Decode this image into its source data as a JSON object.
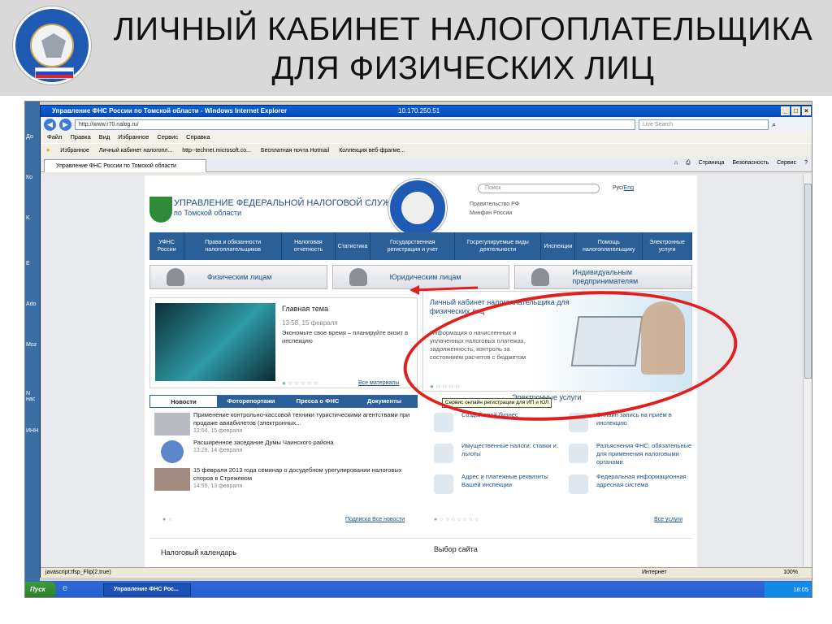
{
  "slide": {
    "title_line1": "ЛИЧНЫЙ КАБИНЕТ НАЛОГОПЛАТЕЛЬЩИКА",
    "title_line2": "ДЛЯ ФИЗИЧЕСКИХ ЛИЦ"
  },
  "left_strip": [
    "До",
    "Ко",
    "K",
    "E",
    "Ado",
    "Moz",
    "N нас",
    "ИНН"
  ],
  "browser": {
    "window_title": "Управление ФНС России по Томской области - Windows Internet Explorer",
    "remote_ip": "10.170.250.51",
    "address": "http://www.r70.nalog.ru/",
    "search_placeholder": "Live Search",
    "menu": [
      "Файл",
      "Правка",
      "Вид",
      "Избранное",
      "Сервис",
      "Справка"
    ],
    "favorites": [
      "Избранное",
      "Личный кабинет налогопл...",
      "http--technet.microsoft.co...",
      "Бесплатная почта Hotmail",
      "Коллекция веб-фрагме..."
    ],
    "tab_title": "Управление ФНС России по Томской области",
    "tab_tools": [
      "Страница",
      "Безопасность",
      "Сервис"
    ],
    "status_text": "javascript:tfsp_Flip(2,true)",
    "status_zone": "Интернет",
    "status_zoom": "100%"
  },
  "site": {
    "name": "УПРАВЛЕНИЕ ФЕДЕРАЛЬНОЙ НАЛОГОВОЙ СЛУЖБЫ",
    "subname": "по Томской области",
    "search_placeholder": "Поиск",
    "lang_ru": "Рус/",
    "lang_en": "Eng",
    "gov_link1": "Правительство РФ",
    "gov_link2": "Минфин России",
    "nav": [
      "УФНС России",
      "Права и обязанности налогоплательщиков",
      "Налоговая отчетность",
      "Статистика",
      "Государственная регистрация и учет",
      "Госрегулируемые виды деятельности",
      "Инспекции",
      "Помощь налогоплательщику",
      "Электронные услуги"
    ],
    "audience": [
      "Физическим лицам",
      "Юридическим лицам",
      "Индивидуальным предпринимателям"
    ],
    "main_topic": {
      "title": "Главная тема",
      "time": "13:58, 15 февраля",
      "text": "Экономьте свое время – планируйте визит в инспекцию",
      "all_link": "Все материалы"
    },
    "cabinet": {
      "title": "Личный кабинет налогоплательщика для физических лиц",
      "text": "Информация о начисленных и уплаченных налоговых платежах, задолженность, контроль за состоянием расчетов с бюджетом"
    },
    "news_tabs": [
      "Новости",
      "Фоторепортажи",
      "Пресса о ФНС",
      "Документы"
    ],
    "news": [
      {
        "title": "Применение контрольно-кассовой техники туристическими агентствами при продаже авиабилетов (электронных...",
        "date": "12:04, 15 февраля"
      },
      {
        "title": "Расширенное заседание Думы Чаинского района",
        "date": "13:28, 14 февраля"
      },
      {
        "title": "15 февраля 2013 года семинар о досудебном урегулировании налоговых споров в Стрежевом",
        "date": "14:55, 13 февраля"
      }
    ],
    "news_links": "Подписка Все новости",
    "services_head": "Электронные услуги",
    "tooltip": "Сервис онлайн регистрации для ИП и ЮЛ",
    "services": [
      "Создай свой бизнес",
      "Онлайн запись на приём в инспекцию",
      "Имущественные налоги: ставки и льготы",
      "Разъяснения ФНС, обязательные для применения налоговыми органами",
      "Адрес и платежные реквизиты Вашей инспекции",
      "Федеральная информационная адресная система"
    ],
    "services_link": "Все услуги",
    "tax_calendar": "Налоговый календарь",
    "site_choice": "Выбор сайта"
  },
  "taskbar": {
    "start": "Пуск",
    "task": "Управление ФНС Рос...",
    "time": "18:05"
  },
  "colors": {
    "annotation": "#e01f1f",
    "nav_blue": "#2a5f98"
  }
}
